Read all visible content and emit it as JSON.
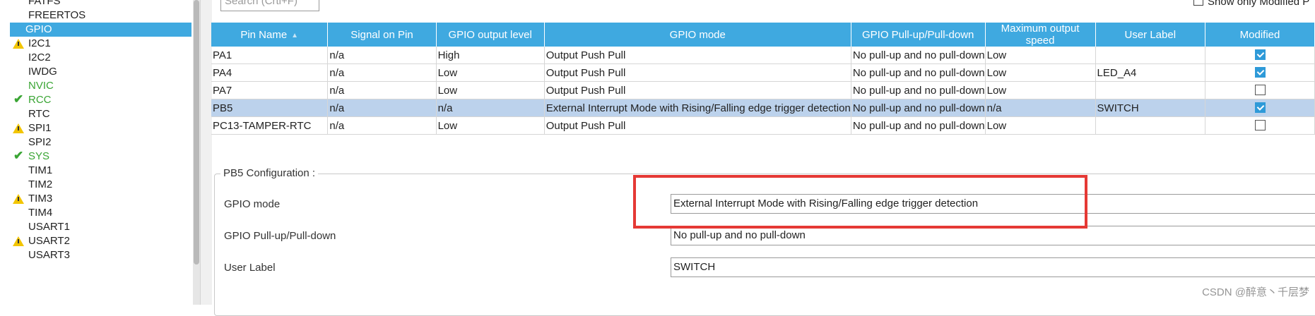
{
  "sidebar": {
    "items": [
      {
        "label": "FATFS",
        "status": "none",
        "selected": false
      },
      {
        "label": "FREERTOS",
        "status": "none",
        "selected": false
      },
      {
        "label": "GPIO",
        "status": "none",
        "selected": true
      },
      {
        "label": "I2C1",
        "status": "warning",
        "selected": false
      },
      {
        "label": "I2C2",
        "status": "none",
        "selected": false
      },
      {
        "label": "IWDG",
        "status": "none",
        "selected": false
      },
      {
        "label": "NVIC",
        "status": "green",
        "selected": false
      },
      {
        "label": "RCC",
        "status": "ok",
        "selected": false
      },
      {
        "label": "RTC",
        "status": "none",
        "selected": false
      },
      {
        "label": "SPI1",
        "status": "warning",
        "selected": false
      },
      {
        "label": "SPI2",
        "status": "none",
        "selected": false
      },
      {
        "label": "SYS",
        "status": "ok",
        "selected": false
      },
      {
        "label": "TIM1",
        "status": "none",
        "selected": false
      },
      {
        "label": "TIM2",
        "status": "none",
        "selected": false
      },
      {
        "label": "TIM3",
        "status": "warning",
        "selected": false
      },
      {
        "label": "TIM4",
        "status": "none",
        "selected": false
      },
      {
        "label": "USART1",
        "status": "none",
        "selected": false
      },
      {
        "label": "USART2",
        "status": "warning",
        "selected": false
      },
      {
        "label": "USART3",
        "status": "none",
        "selected": false
      }
    ]
  },
  "search": {
    "placeholder": "Search (Crtl+F)"
  },
  "show_modified": {
    "label": "Show only Modified P",
    "checked": false
  },
  "table": {
    "columns": [
      "Pin Name",
      "Signal on Pin",
      "GPIO output level",
      "GPIO mode",
      "GPIO Pull-up/Pull-down",
      "Maximum output speed",
      "User Label",
      "Modified"
    ],
    "rows": [
      {
        "pin": "PA1",
        "signal": "n/a",
        "level": "High",
        "mode": "Output Push Pull",
        "pull": "No pull-up and no pull-down",
        "speed": "Low",
        "label": "",
        "modified": true,
        "selected": false
      },
      {
        "pin": "PA4",
        "signal": "n/a",
        "level": "Low",
        "mode": "Output Push Pull",
        "pull": "No pull-up and no pull-down",
        "speed": "Low",
        "label": "LED_A4",
        "modified": true,
        "selected": false
      },
      {
        "pin": "PA7",
        "signal": "n/a",
        "level": "Low",
        "mode": "Output Push Pull",
        "pull": "No pull-up and no pull-down",
        "speed": "Low",
        "label": "",
        "modified": false,
        "selected": false
      },
      {
        "pin": "PB5",
        "signal": "n/a",
        "level": "n/a",
        "mode": "External Interrupt Mode with Rising/Falling edge trigger detection",
        "pull": "No pull-up and no pull-down",
        "speed": "n/a",
        "label": "SWITCH",
        "modified": true,
        "selected": true
      },
      {
        "pin": "PC13-TAMPER-RTC",
        "signal": "n/a",
        "level": "Low",
        "mode": "Output Push Pull",
        "pull": "No pull-up and no pull-down",
        "speed": "Low",
        "label": "",
        "modified": false,
        "selected": false
      }
    ]
  },
  "config": {
    "title": "PB5 Configuration :",
    "fields": [
      {
        "label": "GPIO mode",
        "value": "External Interrupt Mode with Rising/Falling edge trigger detection"
      },
      {
        "label": "GPIO Pull-up/Pull-down",
        "value": "No pull-up and no pull-down"
      },
      {
        "label": "User Label",
        "value": "SWITCH"
      }
    ]
  },
  "watermark": "CSDN @醉意丶千层梦",
  "colors": {
    "accent": "#3fa9e0",
    "selected_row": "#bcd2ec",
    "highlight": "#e53935",
    "ok": "#3aa534",
    "warning": "#f2c500"
  }
}
